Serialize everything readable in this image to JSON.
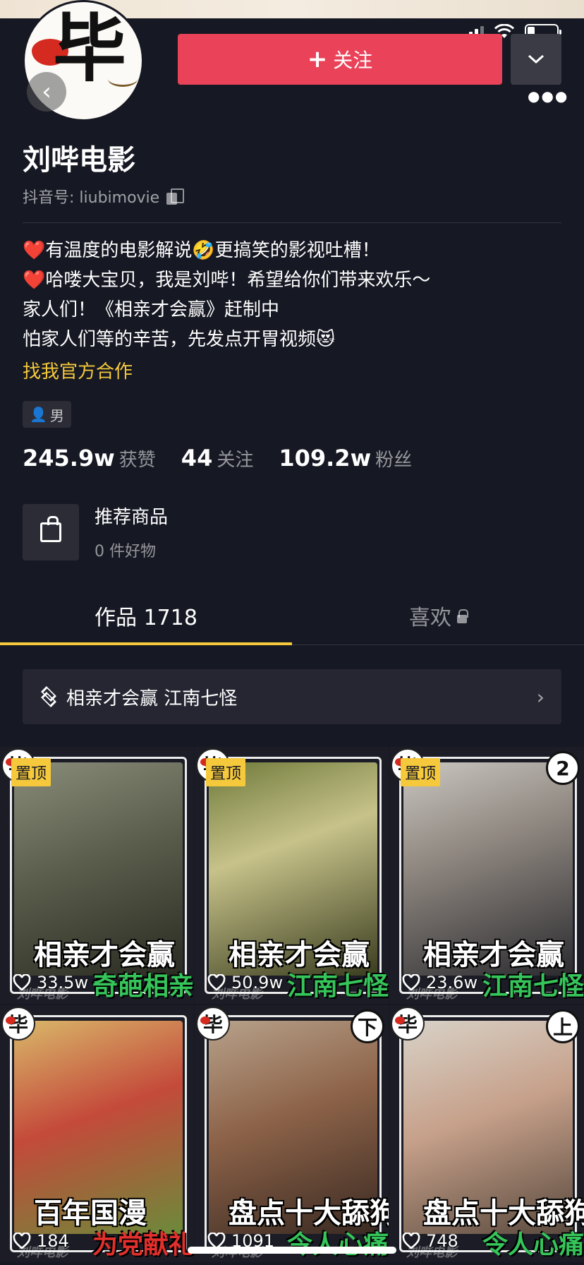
{
  "status_bar": {
    "battery_level": 0.25
  },
  "profile": {
    "name": "刘哔电影",
    "douyin_id_label": "抖音号: liubimovie",
    "follow_label": "关注",
    "follow_color": "#ea4359",
    "avatar_glyph": "毕",
    "bio_lines": [
      {
        "prefix": "❤️",
        "text": "有温度的电影解说🤣更搞笑的影视吐槽！"
      },
      {
        "prefix": "❤️",
        "text": "哈喽大宝贝，我是刘哔！希望给你们带来欢乐～"
      },
      {
        "prefix": "",
        "text": "家人们！《相亲才会赢》赶制中"
      },
      {
        "prefix": "",
        "text": "怕家人们等的辛苦，先发点开胃视频😻"
      }
    ],
    "cooperation_link": "找我官方合作",
    "gender": "男",
    "stats": {
      "likes_num": "245.9w",
      "likes_label": "获赞",
      "following_num": "44",
      "following_label": "关注",
      "followers_num": "109.2w",
      "followers_label": "粉丝"
    },
    "shop": {
      "title": "推荐商品",
      "subtitle": "0 件好物"
    }
  },
  "tabs": {
    "works": "作品 1718",
    "likes": "喜欢"
  },
  "collection": {
    "label": "相亲才会赢 江南七怪"
  },
  "videos": [
    {
      "pin": "置顶",
      "badge": "",
      "likes": "33.5w",
      "overlay_top": "相亲才会赢",
      "overlay_bottom": "奇葩相亲",
      "overlay_bottom_color": "green",
      "bg": "linear-gradient(160deg,#8a8c7a 0%,#5b5e4c 45%,#2a2b22 100%)"
    },
    {
      "pin": "置顶",
      "badge": "",
      "likes": "50.9w",
      "overlay_top": "相亲才会赢",
      "overlay_bottom": "江南七怪",
      "overlay_bottom_color": "green",
      "bg": "linear-gradient(160deg,#6f7a3a 0%,#c7c28a 40%,#3a3d1f 100%)"
    },
    {
      "pin": "置顶",
      "badge": "2",
      "likes": "23.6w",
      "overlay_top": "相亲才会赢",
      "overlay_bottom": "江南七怪",
      "overlay_bottom_color": "green",
      "bg": "linear-gradient(160deg,#c9c6c0 0%,#8f8780 40%,#2b2b2f 100%)"
    },
    {
      "pin": "",
      "badge": "",
      "likes": "184",
      "overlay_top": "百年国漫",
      "overlay_bottom": "为党献礼",
      "overlay_bottom_color": "red",
      "bg": "linear-gradient(160deg,#d9b86a 0%,#c44a3a 45%,#6c8a3a 100%)"
    },
    {
      "pin": "",
      "badge": "下",
      "likes": "1091",
      "overlay_top": "盘点十大舔狗",
      "overlay_bottom": "令人心痛",
      "overlay_bottom_color": "green",
      "bg": "linear-gradient(160deg,#b7a18a 0%,#8c6248 45%,#3a2a22 100%)"
    },
    {
      "pin": "",
      "badge": "上",
      "likes": "748",
      "overlay_top": "盘点十大舔狗",
      "overlay_bottom": "令人心痛",
      "overlay_bottom_color": "green",
      "bg": "linear-gradient(160deg,#d8d2c8 0%,#c6a08a 45%,#5a4a3e 100%)"
    }
  ],
  "watermark": "刘哔电影"
}
